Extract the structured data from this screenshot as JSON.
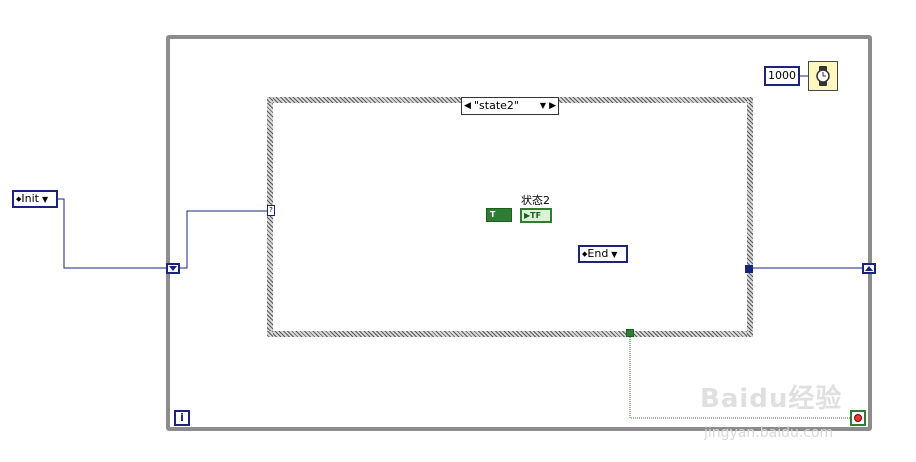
{
  "init_constant": {
    "value": "Init"
  },
  "wait_timeout": {
    "value": "1000"
  },
  "case_selector": {
    "value": "\"state2\""
  },
  "boolean_indicator": {
    "label": "状态2",
    "const_text": "T",
    "ind_text": "TF"
  },
  "end_constant": {
    "value": "End"
  },
  "iteration_terminal": {
    "text": "i"
  },
  "watermark": {
    "main": "Baidu经验",
    "sub": "jingyan.baidu.com"
  },
  "colors": {
    "enum_wire": "#1a237e",
    "bool_wire": "#2e7d32",
    "loop_border": "#8c8c8c"
  }
}
